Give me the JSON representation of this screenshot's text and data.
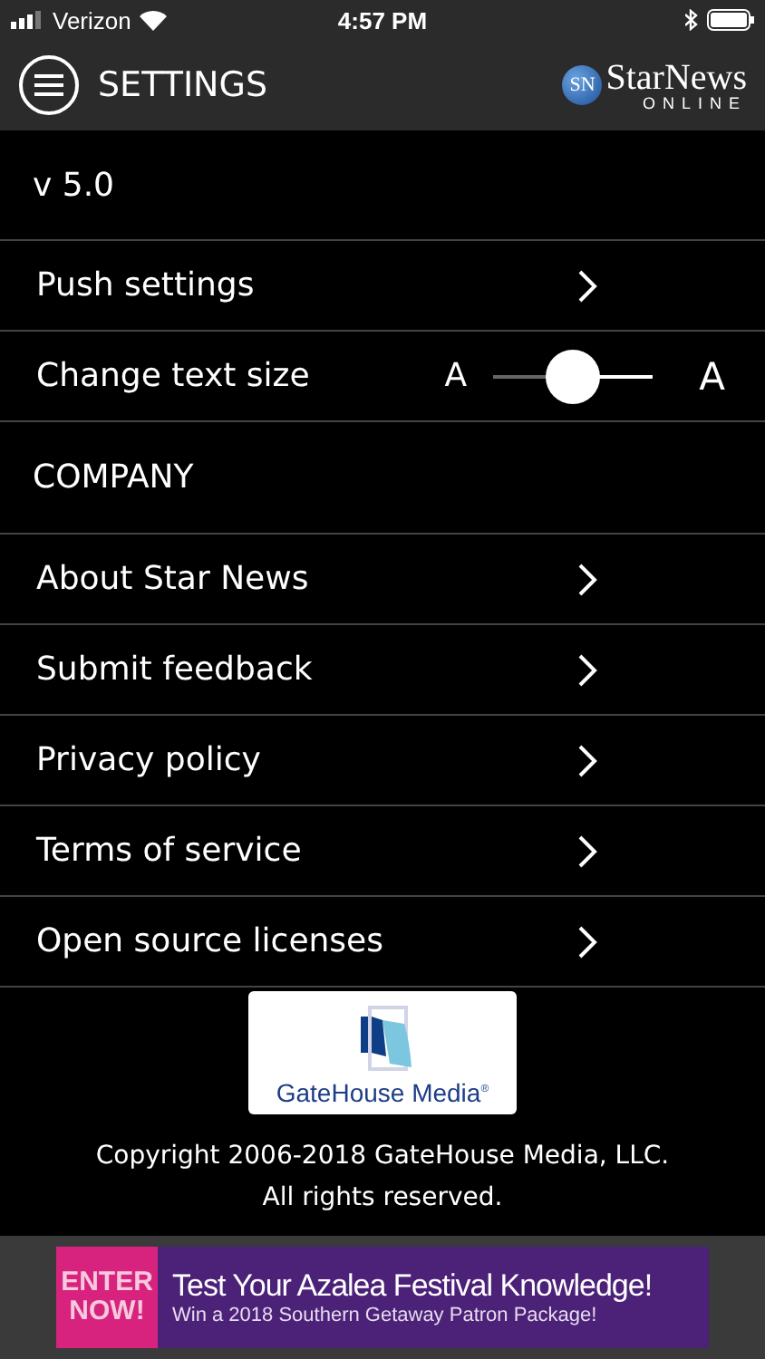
{
  "status_bar": {
    "carrier": "Verizon",
    "time": "4:57 PM"
  },
  "header": {
    "title": "SETTINGS",
    "logo_main": "StarNews",
    "logo_sub": "ONLINE",
    "logo_badge": "SN"
  },
  "version": "v 5.0",
  "settings": [
    {
      "kind": "link",
      "label": "Push settings"
    },
    {
      "kind": "slider",
      "label": "Change text size",
      "small_label": "A",
      "large_label": "A",
      "level": 0.5
    }
  ],
  "section_title": "COMPANY",
  "company_items": [
    "About Star News",
    "Submit feedback",
    "Privacy policy",
    "Terms of service",
    "Open source licenses"
  ],
  "footer": {
    "logo_text": "GateHouse",
    "logo_text2": "Media",
    "logo_mark": "®",
    "copyright": "Copyright 2006-2018 GateHouse Media, LLC.",
    "rights": "All rights reserved."
  },
  "ad": {
    "badge_line1": "ENTER",
    "badge_line2": "NOW!",
    "headline": "Test Your Azalea Festival Knowledge!",
    "subline": "Win a 2018 Southern Getaway Patron Package!"
  }
}
